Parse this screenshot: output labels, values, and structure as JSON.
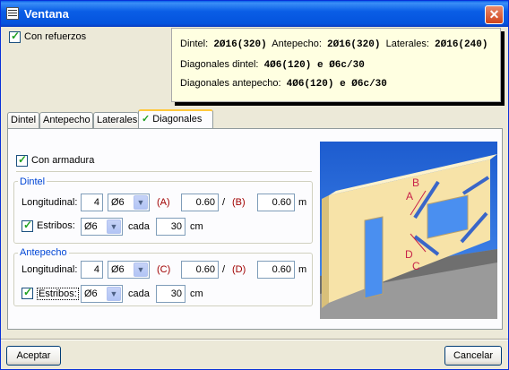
{
  "window": {
    "title": "Ventana"
  },
  "refuerzos": {
    "label": "Con refuerzos",
    "checked": true
  },
  "info": {
    "row1": {
      "dintel_label": "Dintel:",
      "dintel_value": "2Ø16(320)",
      "antepecho_label": "Antepecho:",
      "antepecho_value": "2Ø16(320)",
      "laterales_label": "Laterales:",
      "laterales_value": "2Ø16(240)"
    },
    "row2": {
      "label": "Diagonales dintel:",
      "value": "4Ø6(120) e Ø6c/30"
    },
    "row3": {
      "label": "Diagonales antepecho:",
      "value": "4Ø6(120) e Ø6c/30"
    }
  },
  "tabs": [
    "Dintel",
    "Antepecho",
    "Laterales",
    "Diagonales"
  ],
  "active_tab": "Diagonales",
  "armadura": {
    "label": "Con armadura",
    "checked": true
  },
  "dintel": {
    "title": "Dintel",
    "longitudinal_label": "Longitudinal:",
    "count": "4",
    "diameter": "Ø6",
    "a_label": "(A)",
    "a_value": "0.60",
    "slash": "/",
    "b_label": "(B)",
    "b_value": "0.60",
    "unit": "m",
    "estribos_label": "Estribos:",
    "estribos_checked": true,
    "estribos_diameter": "Ø6",
    "cada_label": "cada",
    "spacing": "30",
    "spacing_unit": "cm"
  },
  "antepecho": {
    "title": "Antepecho",
    "longitudinal_label": "Longitudinal:",
    "count": "4",
    "diameter": "Ø6",
    "c_label": "(C)",
    "c_value": "0.60",
    "slash": "/",
    "d_label": "(D)",
    "d_value": "0.60",
    "unit": "m",
    "estribos_label": "Estribos:",
    "estribos_checked": true,
    "estribos_diameter": "Ø6",
    "cada_label": "cada",
    "spacing": "30",
    "spacing_unit": "cm"
  },
  "diagram_labels": {
    "a": "A",
    "b": "B",
    "c": "C",
    "d": "D"
  },
  "buttons": {
    "accept": "Aceptar",
    "cancel": "Cancelar"
  }
}
